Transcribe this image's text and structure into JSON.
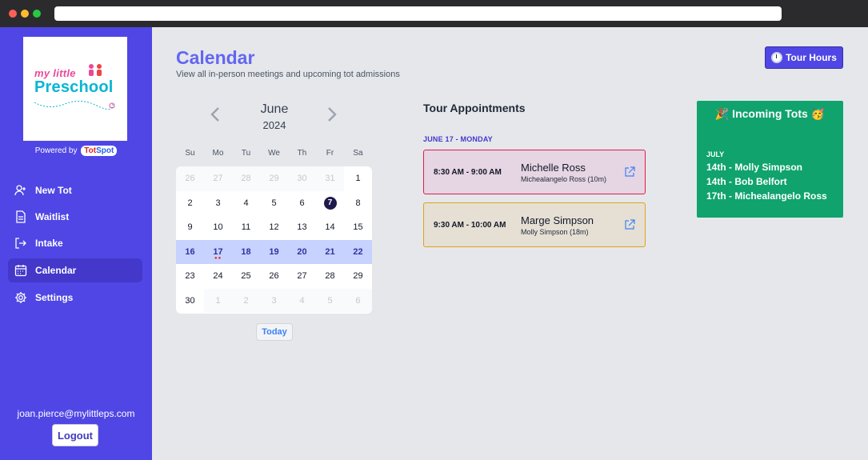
{
  "sidebar": {
    "logo_top": "my little",
    "logo_main": "Preschool",
    "powered_by": "Powered by",
    "brand_part1": "Tot",
    "brand_part2": "Spot",
    "nav": [
      {
        "label": "New Tot",
        "icon": "user-plus-icon"
      },
      {
        "label": "Waitlist",
        "icon": "document-icon"
      },
      {
        "label": "Intake",
        "icon": "login-icon"
      },
      {
        "label": "Calendar",
        "icon": "calendar-icon"
      },
      {
        "label": "Settings",
        "icon": "gear-icon"
      }
    ],
    "active_item": "Calendar",
    "user_email": "joan.pierce@mylittleps.com",
    "logout_label": "Logout"
  },
  "header": {
    "title": "Calendar",
    "subtitle": "View all in-person meetings and upcoming tot admissions",
    "tour_hours_label": "Tour Hours"
  },
  "calendar": {
    "month": "June",
    "year": "2024",
    "weekdays": [
      "Su",
      "Mo",
      "Tu",
      "We",
      "Th",
      "Fr",
      "Sa"
    ],
    "weeks": [
      [
        "26",
        "27",
        "28",
        "29",
        "30",
        "31",
        "1"
      ],
      [
        "2",
        "3",
        "4",
        "5",
        "6",
        "7",
        "8"
      ],
      [
        "9",
        "10",
        "11",
        "12",
        "13",
        "14",
        "15"
      ],
      [
        "16",
        "17",
        "18",
        "19",
        "20",
        "21",
        "22"
      ],
      [
        "23",
        "24",
        "25",
        "26",
        "27",
        "28",
        "29"
      ],
      [
        "30",
        "1",
        "2",
        "3",
        "4",
        "5",
        "6"
      ]
    ],
    "today_label": "Today"
  },
  "appointments": {
    "title": "Tour Appointments",
    "date_label": "JUNE 17 - MONDAY",
    "items": [
      {
        "time": "8:30 AM - 9:00 AM",
        "parent": "Michelle Ross",
        "child": "Michealangelo Ross (10m)",
        "color": "#e11d48"
      },
      {
        "time": "9:30 AM - 10:00 AM",
        "parent": "Marge Simpson",
        "child": "Molly Simpson (18m)",
        "color": "#e0a21b"
      }
    ]
  },
  "incoming_tots": {
    "title": "🎉 Incoming Tots 🥳",
    "month": "JULY",
    "rows": [
      "14th  -  Molly Simpson",
      "14th  -  Bob Belfort",
      "17th  -  Michealangelo Ross"
    ]
  },
  "colors": {
    "sidebar": "#4f46e5",
    "accent": "#6366f1",
    "tots_green": "#10a36e"
  }
}
